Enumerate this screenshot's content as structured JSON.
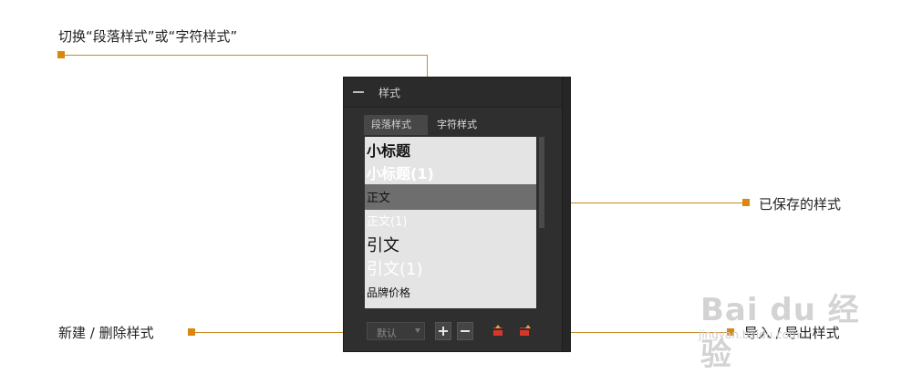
{
  "callouts": {
    "top": "切换“段落样式”或“字符样式”",
    "right": "已保存的样式",
    "left_bottom": "新建 / 删除样式",
    "right_bottom": "导入 / 导出样式"
  },
  "panel": {
    "title": "样式",
    "tabs": [
      "段落样式",
      "字符样式"
    ],
    "active_tab": "段落样式",
    "styles": [
      "小标题",
      "小标题(1)",
      "正文",
      "正文(1)",
      "引文",
      "引文(1)",
      "品牌价格"
    ],
    "selected_style": "正文",
    "dropdown_value": "默认"
  },
  "icons": {
    "collapse": "minus-icon",
    "new": "plus-icon",
    "delete": "minus-icon",
    "import": "import-icon",
    "export": "export-icon"
  },
  "colors": {
    "accent": "#d9870f",
    "panel_bg": "#2f2f2f",
    "list_bg": "#e4e4e4",
    "selected_row": "#6e6e6e",
    "icon_red": "#d8352b"
  },
  "watermark": {
    "main": "Bai du 经验",
    "sub": "jingyan.baidu.com"
  }
}
